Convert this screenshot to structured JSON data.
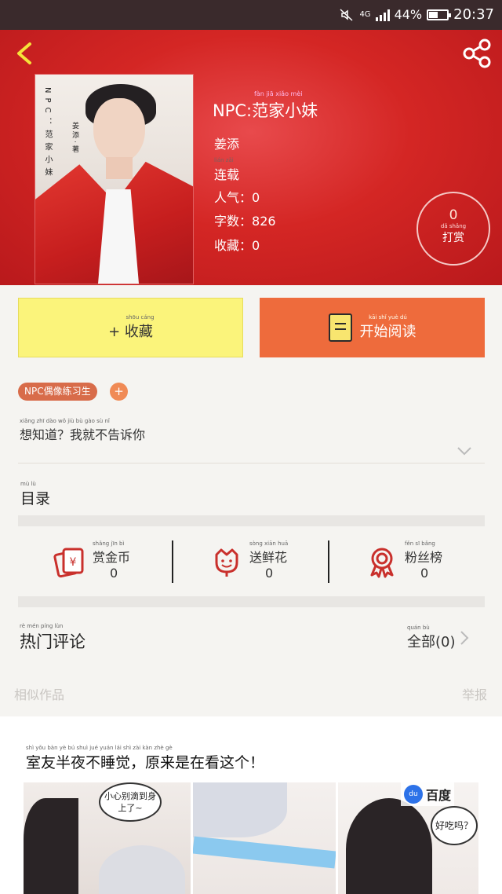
{
  "status_bar": {
    "network": "4G",
    "battery": "44%",
    "time": "20:37"
  },
  "icons": {
    "back": "back-chevron-icon",
    "share": "share-icon",
    "expand": "chevron-down-icon",
    "arrow": "chevron-right-icon"
  },
  "book": {
    "title": "NPC:范家小妹",
    "title_pinyin": "fàn jiā xiǎo mèi",
    "author": "姜添",
    "status": "连载",
    "status_pinyin": "lián zǎi",
    "popularity_label": "人气：",
    "popularity": "0",
    "word_count_label": "字数：",
    "word_count": "826",
    "favorites_label": "收藏：",
    "favorites": "0",
    "cover_vertical_text": "NPC：范家小妹",
    "cover_vertical_text2": "姜添·著"
  },
  "tip": {
    "count": "0",
    "label": "打赏",
    "label_pinyin": "dǎ shǎng"
  },
  "actions": {
    "favorite": "+ 收藏",
    "favorite_pinyin": "shōu cáng",
    "read": "开始阅读",
    "read_pinyin": "kāi shǐ yuè dú"
  },
  "tag": {
    "label": "NPC偶像练习生",
    "add": "+"
  },
  "intro": {
    "text": "想知道？我就不告诉你",
    "pinyin": "xiǎng zhī dào   wǒ jiù bù gào sù nǐ"
  },
  "toc": {
    "label": "目录",
    "pinyin": "mù lù"
  },
  "stats": [
    {
      "label": "赏金币",
      "pinyin": "shǎng jīn bì",
      "value": "0",
      "icon": "red-envelope-icon"
    },
    {
      "label": "送鲜花",
      "pinyin": "sòng xiān huā",
      "value": "0",
      "icon": "flower-icon"
    },
    {
      "label": "粉丝榜",
      "pinyin": "fěn sī bǎng",
      "value": "0",
      "icon": "medal-icon"
    }
  ],
  "comments": {
    "title": "热门评论",
    "title_pinyin": "rè mén píng lùn",
    "all_label": "全部(0)",
    "all_pinyin": "quán bù"
  },
  "similar": {
    "label": "相似作品",
    "report": "举报"
  },
  "ad": {
    "title": "室友半夜不睡觉，原来是在看这个！",
    "title_pinyin": "shì yǒu bàn yè bú shuì jué   yuán lái shì zài kàn zhè gè",
    "bubble1": "小心别滴到身上了~",
    "bubble2": "好吃吗？",
    "brand": "百度"
  },
  "colors": {
    "header": "#d42624",
    "favorite_button": "#fbf47b",
    "read_button": "#ee6b3c",
    "tag": "#d86c4a",
    "stat_icon": "#c9302c"
  }
}
